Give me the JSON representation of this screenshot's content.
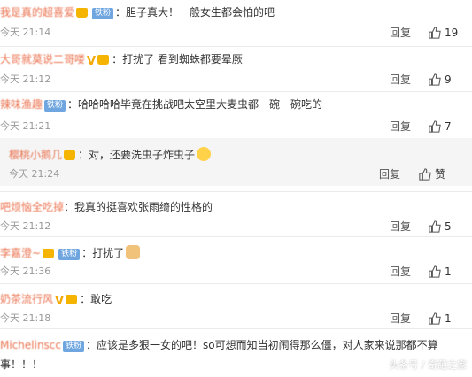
{
  "labels": {
    "reply": "回复",
    "like_zan": "赞"
  },
  "comments": [
    {
      "user": "我是真的超喜爱",
      "text": "胆子真大！一般女生都会怕的吧",
      "time": "今天 21:14",
      "likes": "19",
      "fans_badge": "铁粉"
    },
    {
      "user": "大哥就莫说二哥喽",
      "text": "打扰了 看到蜘蛛都要晕厥",
      "time": "今天 21:12",
      "likes": "9"
    },
    {
      "user": "辣味渔趣",
      "text": "哈哈哈哈毕竟在挑战吧太空里大麦虫都一碗一碗吃的",
      "time": "今天 21:21",
      "likes": "7",
      "fans_badge": "铁粉"
    },
    {
      "user": "樱桃小鹅几",
      "text": "对，还要洗虫子炸虫子",
      "time": "今天 21:24",
      "likes": "赞"
    },
    {
      "user": "吧烦恼全吃掉",
      "text": "我真的挺喜欢张雨绮的性格的",
      "time": "今天 21:12",
      "likes": "5"
    },
    {
      "user": "李嘉澄~",
      "text": "打扰了",
      "time": "今天 21:36",
      "likes": "1",
      "fans_badge": "铁粉"
    },
    {
      "user": "奶茶流行风",
      "text": "敢吃",
      "time": "今天 21:18",
      "likes": "1"
    },
    {
      "user": "Michelinscc",
      "text": "应该是多狠一女的吧！so可想而知当初闹得那么僵，对人家来说那都不算",
      "text2": "事！！！",
      "fans_badge": "铁粉"
    }
  ],
  "watermark": "头条号 / 奇葩之家"
}
